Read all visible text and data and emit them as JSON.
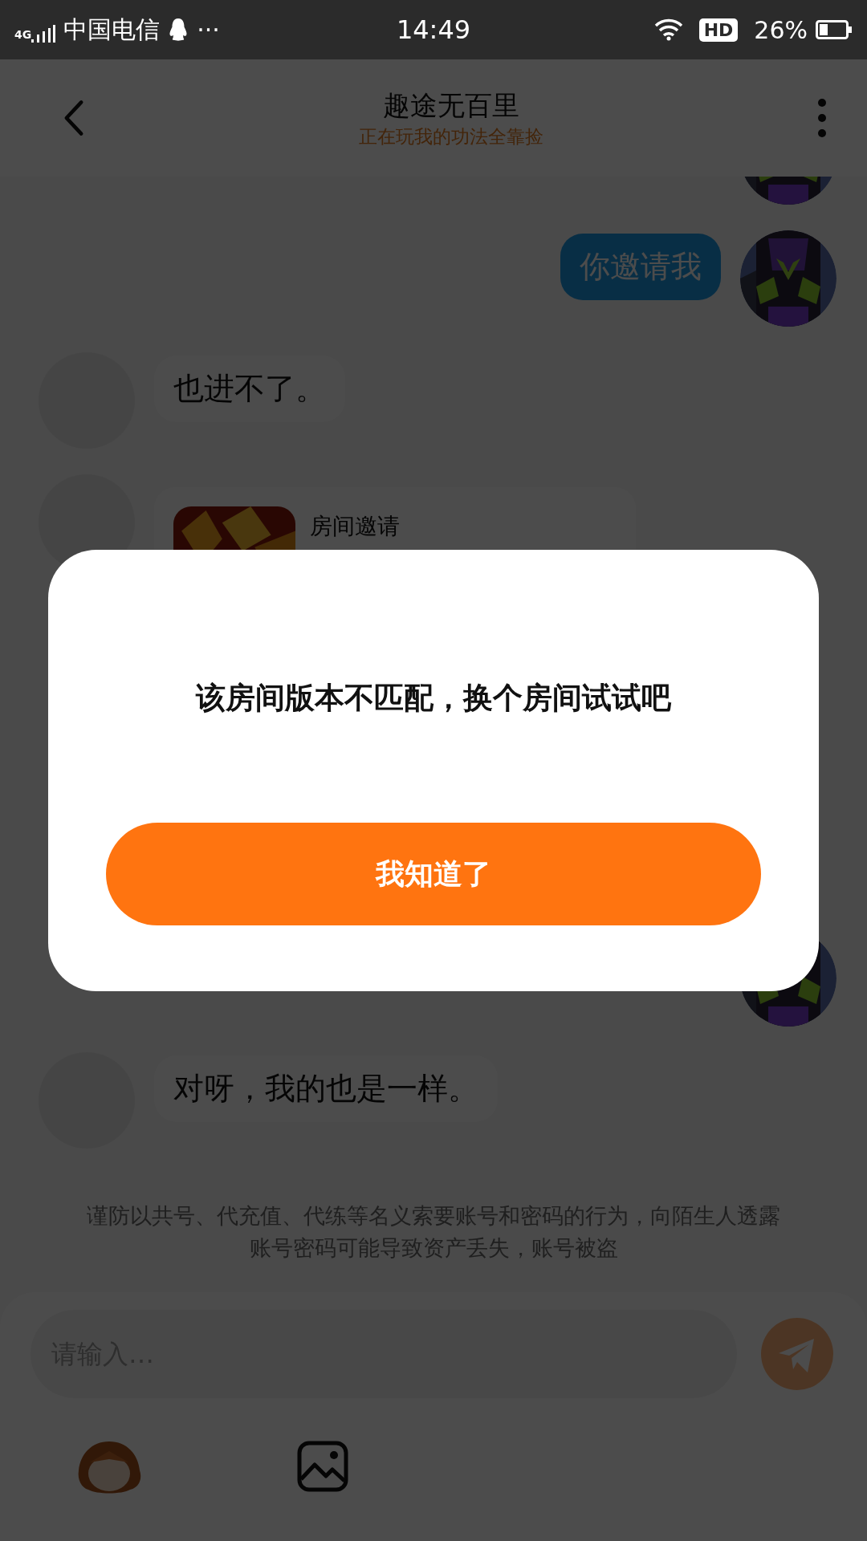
{
  "status_bar": {
    "network": "4G",
    "carrier": "中国电信",
    "more": "···",
    "time": "14:49",
    "hd": "HD",
    "battery": "26%"
  },
  "header": {
    "title": "趣途无百里",
    "subtitle": "正在玩我的功法全靠捡"
  },
  "messages": [
    {
      "kind": "avatar_only",
      "outgoing": true
    },
    {
      "kind": "text",
      "outgoing": true,
      "text": "你邀请我"
    },
    {
      "kind": "text",
      "outgoing": false,
      "text": "也进不了。"
    },
    {
      "kind": "invite",
      "outgoing": false,
      "title": "房间邀请"
    },
    {
      "kind": "avatar_only",
      "outgoing": true
    },
    {
      "kind": "text",
      "outgoing": false,
      "text": "对呀，我的也是一样。"
    }
  ],
  "notice": "谨防以共号、代充值、代练等名义索要账号和密码的行为，向陌生人透露账号密码可能导致资产丢失，账号被盗",
  "composer": {
    "placeholder": "请输入…"
  },
  "dialog": {
    "message": "该房间版本不匹配，换个房间试试吧",
    "button": "我知道了"
  }
}
